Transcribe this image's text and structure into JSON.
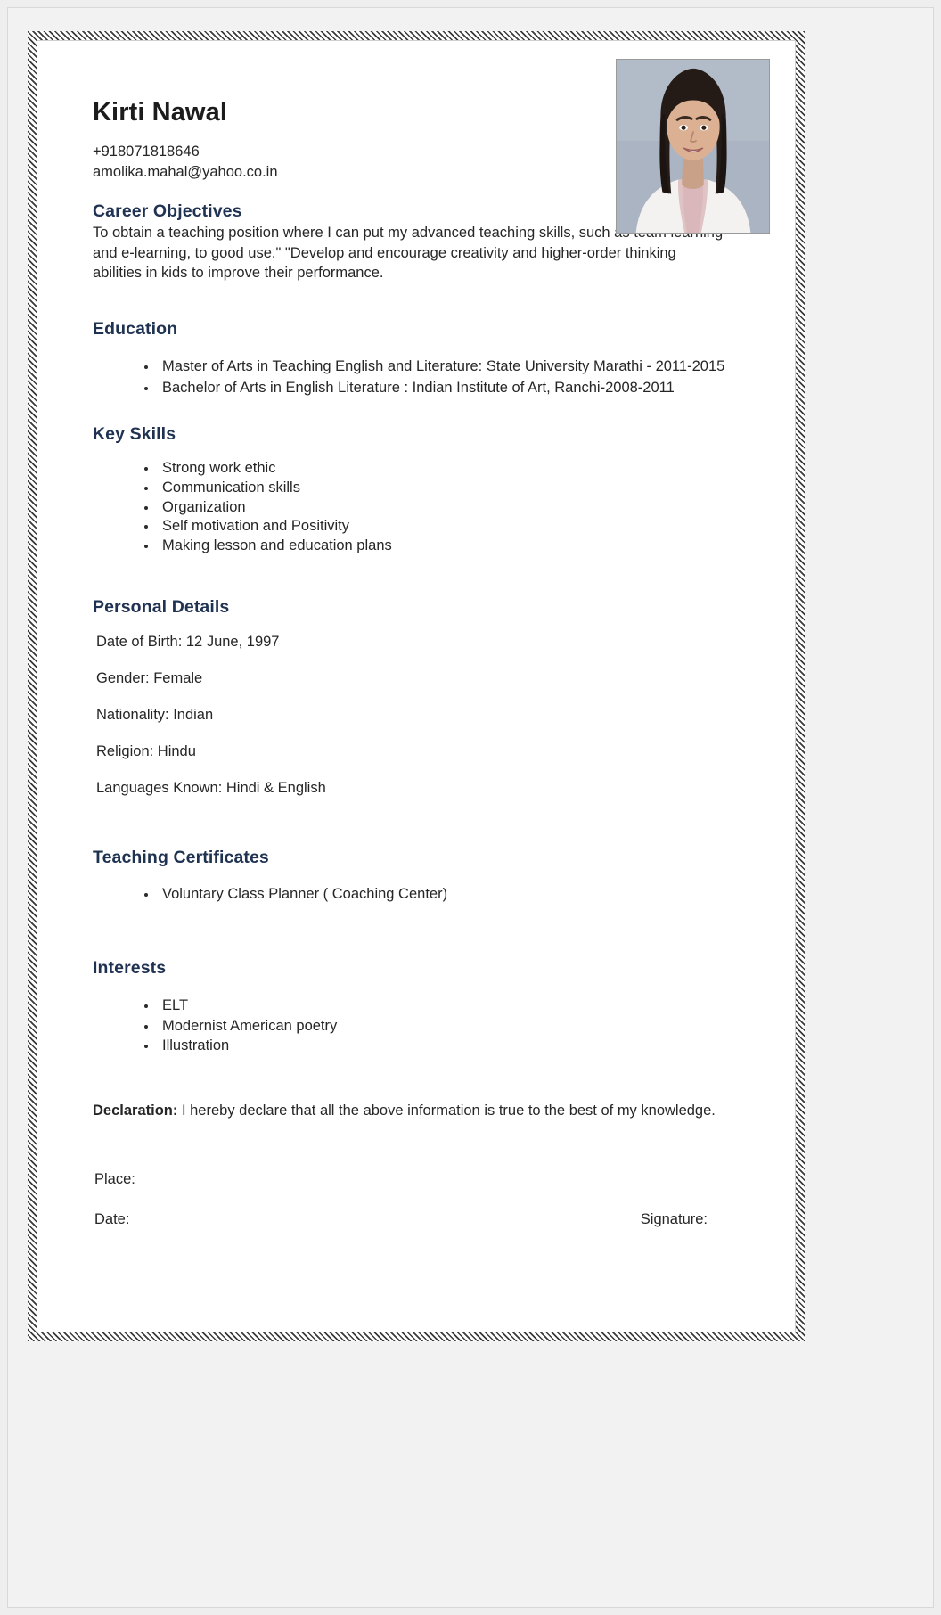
{
  "document": {
    "type": "resume",
    "header": {
      "full_name": "Kirti Nawal",
      "phone": "+918071818646",
      "email": "amolika.mahal@yahoo.co.in",
      "photo_alt": "portrait-photo"
    },
    "career": {
      "heading": "Career Objectives",
      "body": "To obtain a teaching position where I can put my advanced teaching skills, such as team learning and e-learning, to good use.\" \"Develop and encourage creativity and higher-order thinking abilities in kids to improve their performance."
    },
    "education": {
      "heading": "Education",
      "items": [
        "Master of Arts in Teaching English and Literature: State University Marathi - 2011-2015",
        "Bachelor of Arts in English Literature : Indian Institute of Art, Ranchi-2008-2011"
      ]
    },
    "key_skills": {
      "heading": "Key Skills",
      "items": [
        "Strong work ethic",
        "Communication skills",
        "Organization",
        "Self motivation and Positivity",
        "Making lesson and education plans"
      ]
    },
    "personal_details": {
      "heading": "Personal Details",
      "rows": [
        "Date of Birth:  12 June, 1997",
        "Gender: Female",
        "Nationality: Indian",
        "Religion: Hindu",
        "Languages Known: Hindi & English"
      ]
    },
    "certificates": {
      "heading": "Teaching Certificates",
      "items": [
        "Voluntary Class Planner ( Coaching Center)"
      ]
    },
    "interests": {
      "heading": "Interests",
      "items": [
        "ELT",
        "Modernist American poetry",
        "Illustration"
      ]
    },
    "declaration": {
      "label": "Declaration:",
      "text": " I hereby declare that all the above information is true to the best of my knowledge."
    },
    "footer": {
      "place_label": "Place:",
      "date_label": "Date:",
      "signature_label": "Signature:"
    },
    "colors": {
      "heading": "#1f3251",
      "body_text": "#262626",
      "name_text": "#1c1c1c",
      "photo_background": "#aab4c2",
      "page_background": "#eeeeee"
    }
  }
}
